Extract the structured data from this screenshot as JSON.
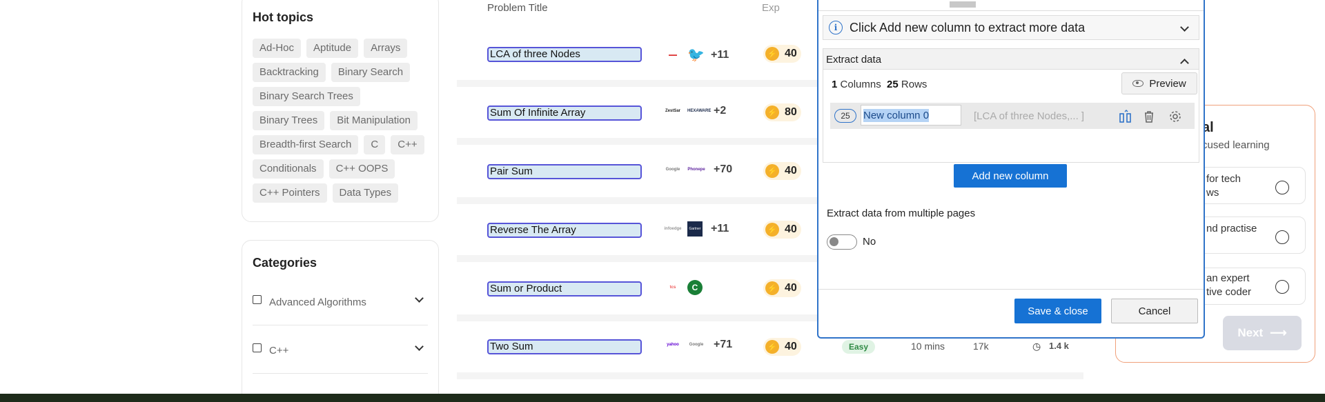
{
  "hot_topics": {
    "title": "Hot topics",
    "chips": [
      "Ad-Hoc",
      "Aptitude",
      "Arrays",
      "Backtracking",
      "Binary Search",
      "Binary Search Trees",
      "Binary Trees",
      "Bit Manipulation",
      "Breadth-first Search",
      "C",
      "C++",
      "Conditionals",
      "C++ OOPS",
      "C++ Pointers",
      "Data Types"
    ]
  },
  "categories": {
    "title": "Categories",
    "items": [
      {
        "label": "Advanced Algorithms"
      },
      {
        "label": "C++"
      }
    ]
  },
  "problems": {
    "header": {
      "title": "Problem Title",
      "exp": "Exp"
    },
    "rows": [
      {
        "title": "LCA of three Nodes",
        "companies": [
          "logo-red",
          "twitter"
        ],
        "extra": "+11",
        "exp": "40"
      },
      {
        "title": "Sum Of Infinite Array",
        "companies": [
          "ZestSar",
          "HEXAWARE"
        ],
        "extra": "+2",
        "exp": "80"
      },
      {
        "title": "Pair Sum",
        "companies": [
          "Google",
          "Phonepe"
        ],
        "extra": "+70",
        "exp": "40"
      },
      {
        "title": "Reverse The Array",
        "companies": [
          "infoedge",
          "Gartner"
        ],
        "extra": "+11",
        "exp": "40"
      },
      {
        "title": "Sum or Product",
        "companies": [
          "tcs",
          "C"
        ],
        "extra": "",
        "exp": "40"
      },
      {
        "title": "Two Sum",
        "companies": [
          "yahoo",
          "Google"
        ],
        "extra": "+71",
        "exp": "40",
        "difficulty": "Easy",
        "time": "10 mins",
        "solved": "17k",
        "likes": "1.4 k"
      }
    ]
  },
  "right_card": {
    "title": "al",
    "subtitle": "cused learning",
    "options": [
      "for tech\nws",
      "nd practise",
      "an expert\ntive coder"
    ],
    "next_label": "Next"
  },
  "panel": {
    "info": "Click Add new column to extract more data",
    "extract_title": "Extract data",
    "columns_count": "1",
    "columns_label": "Columns",
    "rows_count": "25",
    "rows_label": "Rows",
    "preview_label": "Preview",
    "column": {
      "badge": "25",
      "name": "New column 0",
      "preview": "[LCA of three Nodes,... ]"
    },
    "add_column_label": "Add new column",
    "multi_pages_label": "Extract data from multiple pages",
    "multi_pages_value": "No",
    "save_label": "Save & close",
    "cancel_label": "Cancel",
    "accent_color": "#1672d4"
  }
}
